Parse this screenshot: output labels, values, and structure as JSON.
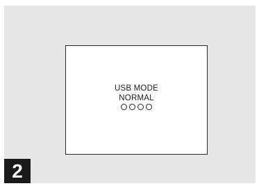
{
  "screen": {
    "line1": "USB MODE",
    "line2": "NORMAL",
    "indicator_count": 4,
    "indicator_shape": "circle-outline"
  },
  "step": {
    "number": "2"
  },
  "colors": {
    "panel_background": "#e6e6e6",
    "screen_background": "#ffffff",
    "screen_border": "#2a2a2a",
    "badge_background": "#1a1a1a",
    "badge_text": "#ffffff"
  }
}
